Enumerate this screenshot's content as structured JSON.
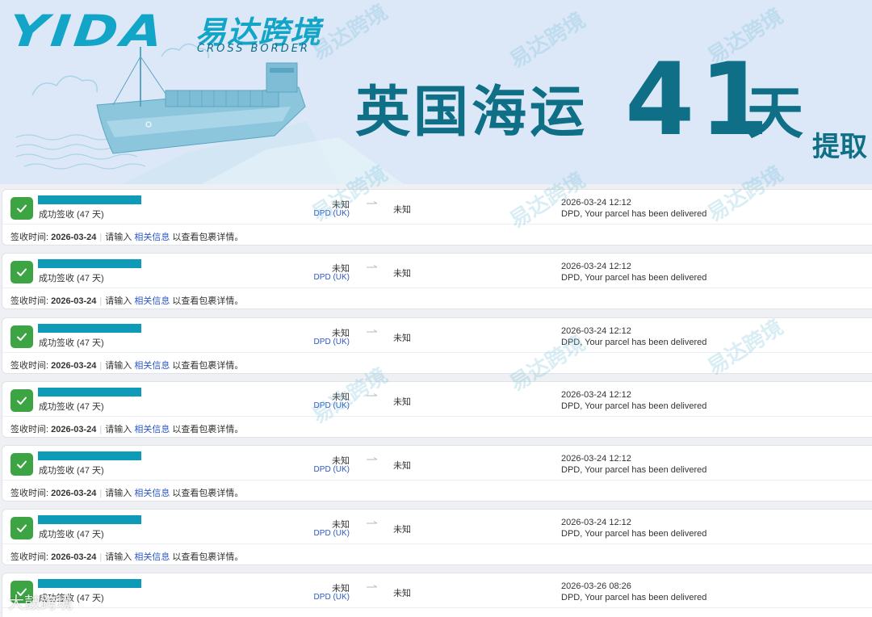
{
  "banner": {
    "logo_text": "YIDA",
    "logo_cn": "易达跨境",
    "logo_sub": "CROSS BORDER",
    "headline": "英国海运",
    "days_number": "41",
    "days_unit": "天",
    "pickup": "提取"
  },
  "watermark_text": "易达跨境",
  "corner_watermark": "大鼓跨境",
  "records": [
    {
      "status": "成功签收 (47 天)",
      "origin": "未知",
      "carrier": "DPD (UK)",
      "destination": "未知",
      "time": "2026-03-24 12:12",
      "event": "DPD, Your parcel has been delivered",
      "footer_label": "签收时间:",
      "footer_date": "2026-03-24",
      "footer_prompt": "请输入",
      "footer_link": "相关信息",
      "footer_suffix": "以查看包裹详情。"
    },
    {
      "status": "成功签收 (47 天)",
      "origin": "未知",
      "carrier": "DPD (UK)",
      "destination": "未知",
      "time": "2026-03-24 12:12",
      "event": "DPD, Your parcel has been delivered",
      "footer_label": "签收时间:",
      "footer_date": "2026-03-24",
      "footer_prompt": "请输入",
      "footer_link": "相关信息",
      "footer_suffix": "以查看包裹详情。"
    },
    {
      "status": "成功签收 (47 天)",
      "origin": "未知",
      "carrier": "DPD (UK)",
      "destination": "未知",
      "time": "2026-03-24 12:12",
      "event": "DPD, Your parcel has been delivered",
      "footer_label": "签收时间:",
      "footer_date": "2026-03-24",
      "footer_prompt": "请输入",
      "footer_link": "相关信息",
      "footer_suffix": "以查看包裹详情。"
    },
    {
      "status": "成功签收 (47 天)",
      "origin": "未知",
      "carrier": "DPD (UK)",
      "destination": "未知",
      "time": "2026-03-24 12:12",
      "event": "DPD, Your parcel has been delivered",
      "footer_label": "签收时间:",
      "footer_date": "2026-03-24",
      "footer_prompt": "请输入",
      "footer_link": "相关信息",
      "footer_suffix": "以查看包裹详情。"
    },
    {
      "status": "成功签收 (47 天)",
      "origin": "未知",
      "carrier": "DPD (UK)",
      "destination": "未知",
      "time": "2026-03-24 12:12",
      "event": "DPD, Your parcel has been delivered",
      "footer_label": "签收时间:",
      "footer_date": "2026-03-24",
      "footer_prompt": "请输入",
      "footer_link": "相关信息",
      "footer_suffix": "以查看包裹详情。"
    },
    {
      "status": "成功签收 (47 天)",
      "origin": "未知",
      "carrier": "DPD (UK)",
      "destination": "未知",
      "time": "2026-03-24 12:12",
      "event": "DPD, Your parcel has been delivered",
      "footer_label": "签收时间:",
      "footer_date": "2026-03-24",
      "footer_prompt": "请输入",
      "footer_link": "相关信息",
      "footer_suffix": "以查看包裹详情。"
    },
    {
      "status": "成功签收 (47 天)",
      "origin": "未知",
      "carrier": "DPD (UK)",
      "destination": "未知",
      "time": "2026-03-26 08:26",
      "event": "DPD, Your parcel has been delivered",
      "footer_label": "",
      "footer_date": "",
      "footer_prompt": "",
      "footer_link": "",
      "footer_suffix": ""
    }
  ],
  "colors": {
    "brand": "#13a5c7",
    "headline": "#0e6f86",
    "success": "#3da443",
    "link": "#2b57c8",
    "redaction": "#0e9bb7"
  },
  "icons": {
    "status": "check-icon",
    "route": "arrow-right-icon"
  }
}
